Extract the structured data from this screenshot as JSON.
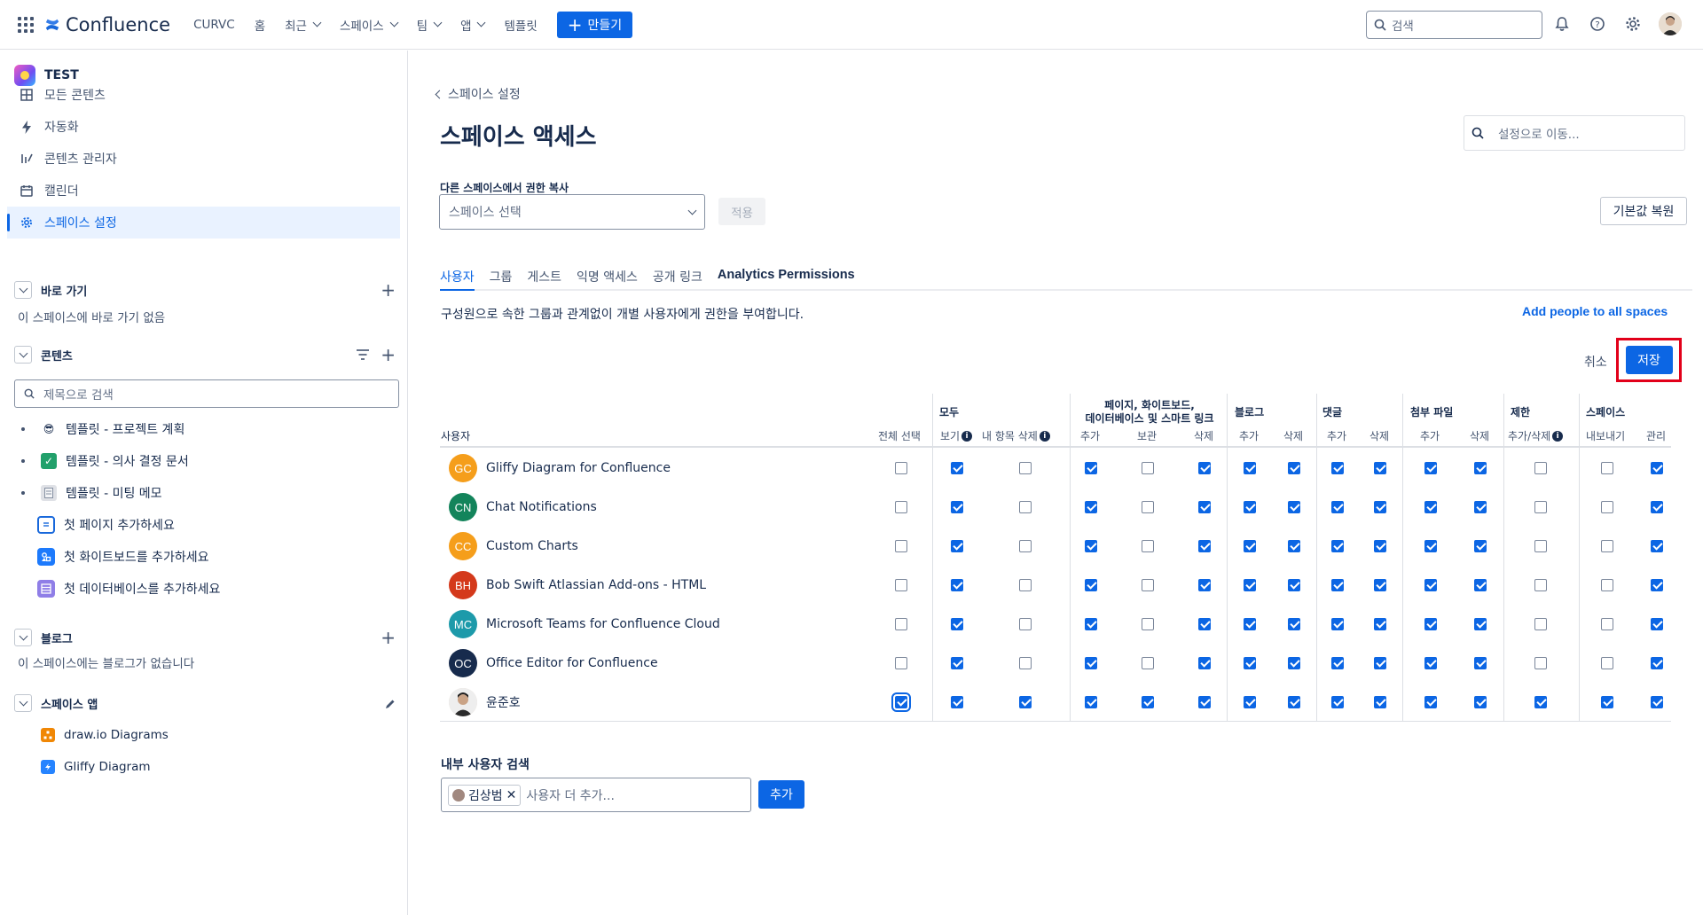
{
  "topnav": {
    "app_name": "Confluence",
    "items": [
      {
        "label": "CURVC",
        "dropdown": false
      },
      {
        "label": "홈",
        "dropdown": false
      },
      {
        "label": "최근",
        "dropdown": true
      },
      {
        "label": "스페이스",
        "dropdown": true
      },
      {
        "label": "팀",
        "dropdown": true
      },
      {
        "label": "앱",
        "dropdown": true
      },
      {
        "label": "템플릿",
        "dropdown": false
      }
    ],
    "create_label": "만들기",
    "search_placeholder": "검색",
    "accent": "#0c66e4"
  },
  "sidebar": {
    "space_name": "TEST",
    "items": [
      {
        "label": "모든 콘텐츠",
        "icon": "grid-icon"
      },
      {
        "label": "자동화",
        "icon": "lightning-icon"
      },
      {
        "label": "콘텐츠 관리자",
        "icon": "content-manager-icon"
      },
      {
        "label": "캘린더",
        "icon": "calendar-icon"
      },
      {
        "label": "스페이스 설정",
        "icon": "gear-icon",
        "active": true
      }
    ],
    "shortcuts": {
      "title": "바로 가기",
      "empty": "이 스페이스에 바로 가기 없음"
    },
    "content": {
      "title": "콘텐츠",
      "search_placeholder": "제목으로 검색",
      "tree": [
        {
          "label": "템플릿 - 프로젝트 계획",
          "icon": "😎",
          "bullet": true
        },
        {
          "label": "템플릿 - 의사 결정 문서",
          "icon": "✅",
          "bullet": true
        },
        {
          "label": "템플릿 - 미팅 메모",
          "icon": "🗒",
          "bullet": true
        },
        {
          "label": "첫 페이지 추가하세요",
          "icon": "page-icon"
        },
        {
          "label": "첫 화이트보드를 추가하세요",
          "icon": "whiteboard-icon"
        },
        {
          "label": "첫 데이터베이스를 추가하세요",
          "icon": "database-icon"
        }
      ]
    },
    "blog": {
      "title": "블로그",
      "empty": "이 스페이스에는 블로그가 없습니다"
    },
    "apps": {
      "title": "스페이스 앱",
      "items": [
        {
          "label": "draw.io Diagrams",
          "color": "#f08705"
        },
        {
          "label": "Gliffy Diagram",
          "color": "#2684ff"
        }
      ]
    }
  },
  "main": {
    "back_label": "스페이스 설정",
    "title": "스페이스 액세스",
    "settings_search_placeholder": "설정으로 이동...",
    "copy_label": "다른 스페이스에서 권한 복사",
    "space_select_placeholder": "스페이스 선택",
    "apply_label": "적용",
    "reset_label": "기본값 복원",
    "tabs": [
      {
        "label": "사용자",
        "active": true
      },
      {
        "label": "그룹"
      },
      {
        "label": "게스트"
      },
      {
        "label": "익명 액세스"
      },
      {
        "label": "공개 링크"
      },
      {
        "label": "Analytics Permissions",
        "strong": true
      }
    ],
    "description": "구성원으로 속한 그룹과 관계없이 개별 사용자에게 권한을 부여합니다.",
    "add_people_label": "Add people to all spaces",
    "cancel_label": "취소",
    "save_label": "저장"
  },
  "table": {
    "user_col": "사용자",
    "select_all": "전체 선택",
    "groups": [
      {
        "label": "모두"
      },
      {
        "label": "페이지, 화이트보드,\n데이터베이스 및 스마트 링크"
      },
      {
        "label": "블로그"
      },
      {
        "label": "댓글"
      },
      {
        "label": "첨부 파일"
      },
      {
        "label": "제한"
      },
      {
        "label": "스페이스"
      }
    ],
    "columns": [
      {
        "label": "보기",
        "info": true
      },
      {
        "label": "내 항목 삭제",
        "info": true
      },
      {
        "label": "추가"
      },
      {
        "label": "보관"
      },
      {
        "label": "삭제"
      },
      {
        "label": "추가"
      },
      {
        "label": "삭제"
      },
      {
        "label": "추가"
      },
      {
        "label": "삭제"
      },
      {
        "label": "추가"
      },
      {
        "label": "삭제"
      },
      {
        "label": "추가/삭제",
        "info": true
      },
      {
        "label": "내보내기"
      },
      {
        "label": "관리"
      }
    ],
    "rows": [
      {
        "initials": "GC",
        "name": "Gliffy Diagram for Confluence",
        "color": "#f59e1b",
        "all": false,
        "perms": [
          true,
          false,
          true,
          false,
          true,
          true,
          true,
          true,
          true,
          true,
          true,
          false,
          false,
          true
        ]
      },
      {
        "initials": "CN",
        "name": "Chat Notifications",
        "color": "#13845b",
        "all": false,
        "perms": [
          true,
          false,
          true,
          false,
          true,
          true,
          true,
          true,
          true,
          true,
          true,
          false,
          false,
          true
        ]
      },
      {
        "initials": "CC",
        "name": "Custom Charts",
        "color": "#f59e1b",
        "all": false,
        "perms": [
          true,
          false,
          true,
          false,
          true,
          true,
          true,
          true,
          true,
          true,
          true,
          false,
          false,
          true
        ]
      },
      {
        "initials": "BH",
        "name": "Bob Swift Atlassian Add-ons - HTML",
        "color": "#d4391b",
        "all": false,
        "perms": [
          true,
          false,
          true,
          false,
          true,
          true,
          true,
          true,
          true,
          true,
          true,
          false,
          false,
          true
        ]
      },
      {
        "initials": "MC",
        "name": "Microsoft Teams for Confluence Cloud",
        "color": "#1d9aaa",
        "all": false,
        "perms": [
          true,
          false,
          true,
          false,
          true,
          true,
          true,
          true,
          true,
          true,
          true,
          false,
          false,
          true
        ]
      },
      {
        "initials": "OC",
        "name": "Office Editor for Confluence",
        "color": "#172b4d",
        "all": false,
        "perms": [
          true,
          false,
          true,
          false,
          true,
          true,
          true,
          true,
          true,
          true,
          true,
          false,
          false,
          true
        ]
      },
      {
        "initials": "",
        "name": "윤준호",
        "color": "#e6d5c3",
        "photo": true,
        "all": true,
        "perms": [
          true,
          true,
          true,
          true,
          true,
          true,
          true,
          true,
          true,
          true,
          true,
          true,
          true,
          true
        ]
      }
    ]
  },
  "user_search": {
    "label": "내부 사용자 검색",
    "chip": "김상범",
    "placeholder": "사용자 더 추가...",
    "add_label": "추가"
  }
}
